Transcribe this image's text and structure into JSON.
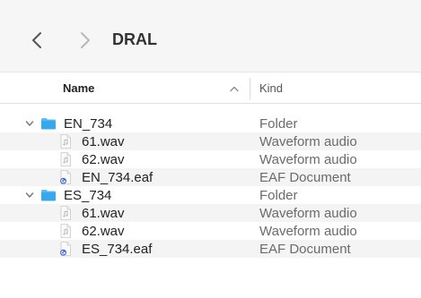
{
  "window": {
    "title": "DRAL",
    "icons": {
      "back": "chevron-left-icon",
      "forward": "chevron-right-icon"
    }
  },
  "columns": {
    "name": "Name",
    "kind": "Kind",
    "sort_icon": "chevron-up-icon"
  },
  "colors": {
    "folder": "#3aa8e8",
    "folder_tab": "#5cbaf0",
    "eaf_badge": "#3b5fd1",
    "row_alt": "#f4f4f4",
    "toolbar_bg": "#f6f6f6"
  },
  "items": [
    {
      "name": "EN_734",
      "kind": "Folder",
      "type": "folder",
      "level": 0,
      "expanded": true
    },
    {
      "name": "61.wav",
      "kind": "Waveform audio",
      "type": "audio",
      "level": 1
    },
    {
      "name": "62.wav",
      "kind": "Waveform audio",
      "type": "audio",
      "level": 1
    },
    {
      "name": "EN_734.eaf",
      "kind": "EAF Document",
      "type": "eaf",
      "level": 1
    },
    {
      "name": "ES_734",
      "kind": "Folder",
      "type": "folder",
      "level": 0,
      "expanded": true
    },
    {
      "name": "61.wav",
      "kind": "Waveform audio",
      "type": "audio",
      "level": 1
    },
    {
      "name": "62.wav",
      "kind": "Waveform audio",
      "type": "audio",
      "level": 1
    },
    {
      "name": "ES_734.eaf",
      "kind": "EAF Document",
      "type": "eaf",
      "level": 1
    }
  ]
}
